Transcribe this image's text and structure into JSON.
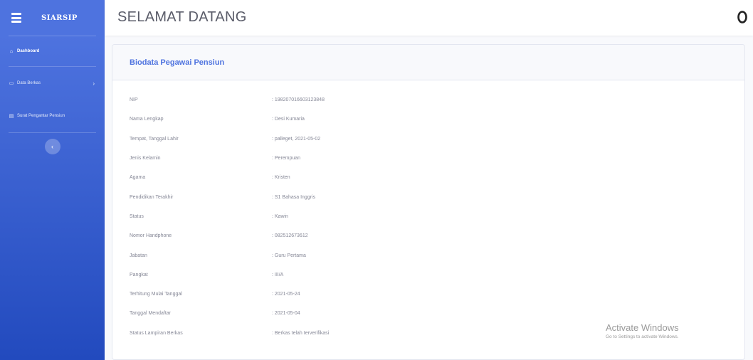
{
  "sidebar": {
    "brand": "SIARSIP",
    "items": [
      {
        "label": "Dashboard",
        "icon": "home-icon",
        "active": true
      },
      {
        "label": "Data Berkas",
        "icon": "folder-icon",
        "active": false
      },
      {
        "label": "Surat Pengantar Pensiun",
        "icon": "file-icon",
        "active": false
      }
    ],
    "toggle_glyph": "‹"
  },
  "topbar": {
    "title": "SELAMAT DATANG"
  },
  "card": {
    "title": "Biodata Pegawai Pensiun",
    "rows": [
      {
        "label": "NIP",
        "value": ": 198207016603123848"
      },
      {
        "label": "Nama Lengkap",
        "value": ": Desi Kumaria"
      },
      {
        "label": "Tempat, Tanggal Lahir",
        "value": ": palleget, 2021-05-02"
      },
      {
        "label": "Jenis Kelamin",
        "value": ": Perempuan"
      },
      {
        "label": "Agama",
        "value": ": Kristen"
      },
      {
        "label": "Pendidikan Terakhir",
        "value": ": S1 Bahasa Inggris"
      },
      {
        "label": "Status",
        "value": ": Kawin"
      },
      {
        "label": "Nomor Handphone",
        "value": ": 082512673612"
      },
      {
        "label": "Jabatan",
        "value": ": Guru Pertama"
      },
      {
        "label": "Pangkat",
        "value": ": III/A"
      },
      {
        "label": "Terhitung Mulai Tanggal",
        "value": ": 2021-05-24"
      },
      {
        "label": "Tanggal Mendaftar",
        "value": ": 2021-05-04"
      },
      {
        "label": "Status Lampiran Berkas",
        "value": ": Berkas telah terverifikasi"
      }
    ]
  },
  "watermark": {
    "title": "Activate Windows",
    "subtitle": "Go to Settings to activate Windows."
  },
  "colors": {
    "primary": "#4e73df",
    "primary_dark": "#224abe",
    "text_muted": "#858796",
    "title": "#5a5c69"
  }
}
